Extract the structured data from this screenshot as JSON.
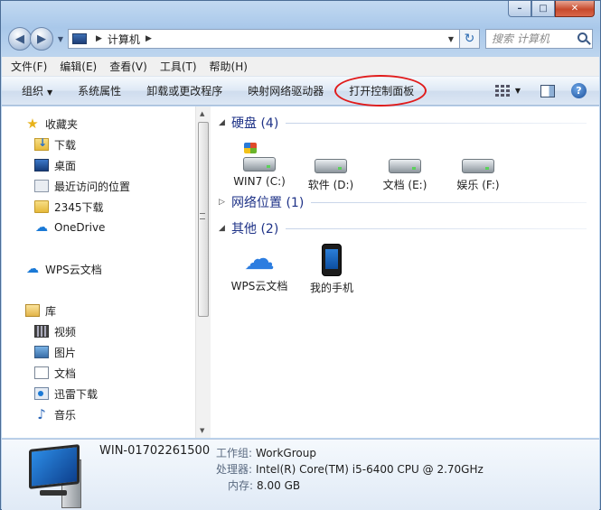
{
  "window": {
    "caption": {
      "minimize": "–",
      "maximize": "□",
      "close": "✕"
    }
  },
  "address_bar": {
    "crumbs": [
      "计算机"
    ],
    "search_placeholder": "搜索 计算机"
  },
  "menu": [
    "文件(F)",
    "编辑(E)",
    "查看(V)",
    "工具(T)",
    "帮助(H)"
  ],
  "commands": {
    "organize": "组织",
    "system_properties": "系统属性",
    "uninstall": "卸载或更改程序",
    "map_drive": "映射网络驱动器",
    "control_panel": "打开控制面板"
  },
  "nav_pane": {
    "favorites": "收藏夹",
    "downloads": "下载",
    "desktop": "桌面",
    "recent": "最近访问的位置",
    "dl2345": "2345下载",
    "onedrive": "OneDrive",
    "wps": "WPS云文档",
    "libraries": "库",
    "videos": "视频",
    "pictures": "图片",
    "documents": "文档",
    "xunlei": "迅雷下载",
    "music": "音乐"
  },
  "groups": {
    "hard_disk": {
      "title": "硬盘 (4)"
    },
    "network": {
      "title": "网络位置 (1)"
    },
    "other": {
      "title": "其他 (2)"
    }
  },
  "drives": [
    "WIN7 (C:)",
    "软件 (D:)",
    "文档 (E:)",
    "娱乐 (F:)"
  ],
  "other_items": [
    "WPS云文档",
    "我的手机"
  ],
  "details": {
    "computer_name": "WIN-01702261500",
    "workgroup_label": "工作组:",
    "workgroup": "WorkGroup",
    "cpu_label": "处理器:",
    "cpu": "Intel(R) Core(TM) i5-6400 CPU @ 2.70GHz",
    "ram_label": "内存:",
    "ram": "8.00 GB"
  },
  "colors": {
    "group_title": "#1e3287",
    "highlight_circle": "#e01b1b"
  }
}
